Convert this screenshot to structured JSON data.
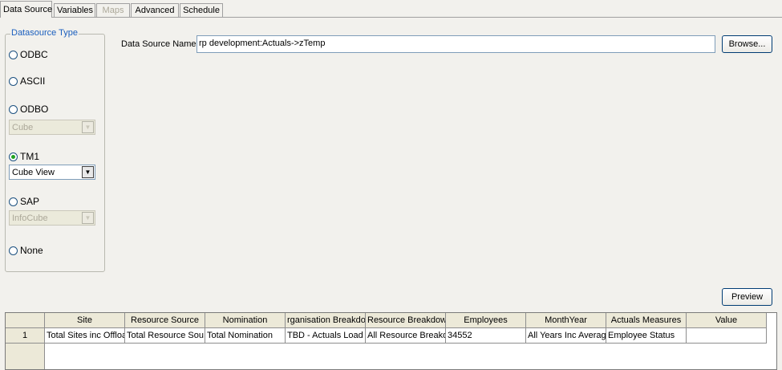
{
  "tabs": [
    {
      "label": "Data Source",
      "active": true,
      "enabled": true
    },
    {
      "label": "Variables",
      "active": false,
      "enabled": true
    },
    {
      "label": "Maps",
      "active": false,
      "enabled": false
    },
    {
      "label": "Advanced",
      "active": false,
      "enabled": true
    },
    {
      "label": "Schedule",
      "active": false,
      "enabled": true
    }
  ],
  "datasource_type": {
    "title": "Datasource Type",
    "options": [
      {
        "label": "ODBC",
        "selected": false
      },
      {
        "label": "ASCII",
        "selected": false
      },
      {
        "label": "ODBO",
        "selected": false
      },
      {
        "label": "TM1",
        "selected": true
      },
      {
        "label": "SAP",
        "selected": false
      },
      {
        "label": "None",
        "selected": false
      }
    ],
    "odbo_combo": "Cube",
    "tm1_combo": "Cube View",
    "sap_combo": "InfoCube"
  },
  "data_source_name": {
    "label": "Data Source Name:",
    "value": "rp development:Actuals->zTemp",
    "browse_label": "Browse..."
  },
  "preview_label": "Preview",
  "grid": {
    "columns": [
      "Site",
      "Resource Source",
      "Nomination",
      "rganisation Breakdov",
      "Resource Breakdowr",
      "Employees",
      "MonthYear",
      "Actuals Measures",
      "Value"
    ],
    "rows": [
      {
        "num": "1",
        "cells": [
          "Total Sites inc Offloa",
          "Total Resource Sou",
          "Total Nomination",
          "TBD - Actuals Load",
          "All Resource Breakd",
          "34552",
          "All Years Inc Averag",
          "Employee Status",
          ""
        ]
      }
    ]
  }
}
